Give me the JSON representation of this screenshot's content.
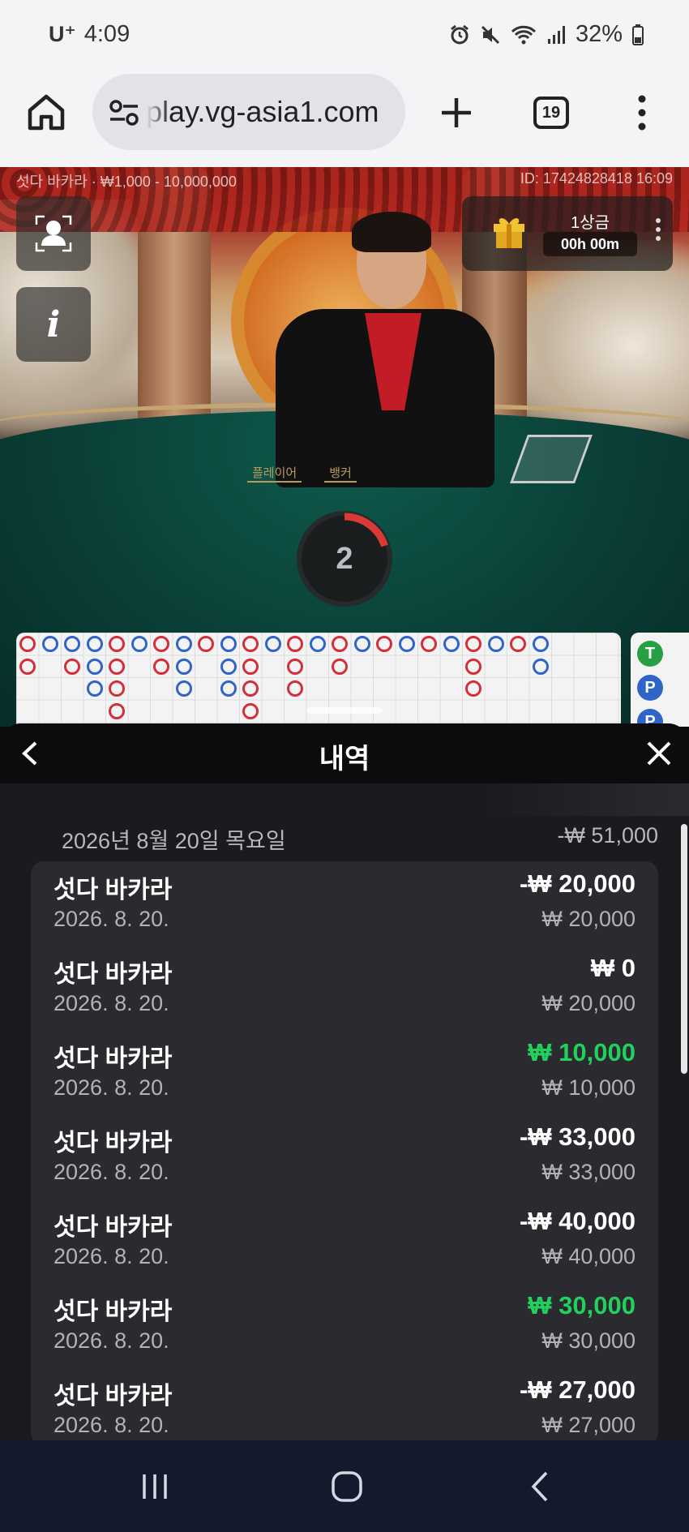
{
  "status_bar": {
    "carrier": "U⁺",
    "time": "4:09",
    "battery": "32%"
  },
  "browser": {
    "url": "play.vg-asia1.com",
    "tab_count": "19"
  },
  "game": {
    "table_info": "섯다 바카라 · ₩1,000 - 10,000,000",
    "round_id": "ID: 17424828418 16:09",
    "bonus_label": "1상금",
    "bonus_timer": "00h 00m",
    "countdown": "2",
    "felt_player": "플레이어",
    "felt_banker": "뱅커",
    "countdown_progress": 0.2,
    "stat_labels": [
      "T",
      "P",
      "P"
    ]
  },
  "history": {
    "title": "내역",
    "date": "2026년 8월 20일 목요일",
    "date_total": "-₩ 51,000",
    "rows": [
      {
        "name": "섯다 바카라",
        "date": "2026. 8. 20.",
        "amount": "-₩ 20,000",
        "bet": "₩ 20,000",
        "win": false
      },
      {
        "name": "섯다 바카라",
        "date": "2026. 8. 20.",
        "amount": "₩ 0",
        "bet": "₩ 20,000",
        "win": false
      },
      {
        "name": "섯다 바카라",
        "date": "2026. 8. 20.",
        "amount": "₩ 10,000",
        "bet": "₩ 10,000",
        "win": true
      },
      {
        "name": "섯다 바카라",
        "date": "2026. 8. 20.",
        "amount": "-₩ 33,000",
        "bet": "₩ 33,000",
        "win": false
      },
      {
        "name": "섯다 바카라",
        "date": "2026. 8. 20.",
        "amount": "-₩ 40,000",
        "bet": "₩ 40,000",
        "win": false
      },
      {
        "name": "섯다 바카라",
        "date": "2026. 8. 20.",
        "amount": "₩ 30,000",
        "bet": "₩ 30,000",
        "win": true
      },
      {
        "name": "섯다 바카라",
        "date": "2026. 8. 20.",
        "amount": "-₩ 27,000",
        "bet": "₩ 27,000",
        "win": false
      }
    ]
  },
  "colors": {
    "win": "#21d05d",
    "banker": "#d32f3a",
    "player": "#2f64c9"
  }
}
